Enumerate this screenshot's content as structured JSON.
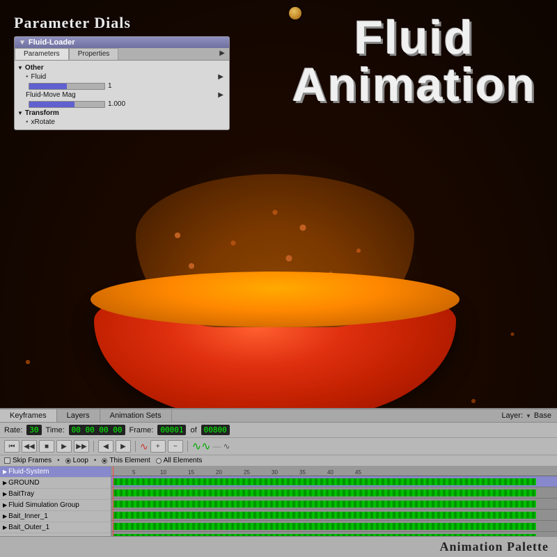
{
  "background": {
    "color": "#1a0800"
  },
  "paramPanel": {
    "title": "Parameter Dials",
    "windowTitle": "Fluid-Loader",
    "tabs": [
      "Parameters",
      "Properties"
    ],
    "activeTab": "Parameters",
    "sections": [
      {
        "name": "Other",
        "collapsed": false,
        "params": [
          {
            "name": "Fluid",
            "sliderValue": 1,
            "sliderPercent": 50,
            "displayValue": "1"
          },
          {
            "name": "Fluid-Move Mag",
            "sliderValue": 1.0,
            "sliderPercent": 60,
            "displayValue": "1.000"
          }
        ]
      },
      {
        "name": "Transform",
        "collapsed": false,
        "params": [
          {
            "name": "xRotate"
          }
        ]
      }
    ]
  },
  "fluidTitle": {
    "line1": "Fluid",
    "line2": "Animation"
  },
  "fallingKibble": {
    "visible": true
  },
  "timelinePanel": {
    "tabs": [
      "Keyframes",
      "Layers",
      "Animation Sets"
    ],
    "activeTab": "Keyframes",
    "layer": {
      "label": "Layer:",
      "value": "Base"
    },
    "controls": {
      "rateLabel": "Rate:",
      "rateValue": "30",
      "timeLabel": "Time:",
      "timeValue": "00 00 00 00",
      "frameLabel": "Frame:",
      "frameValue": "00001",
      "ofLabel": "of",
      "totalFrames": "00800"
    },
    "options": {
      "skipFrames": "Skip Frames",
      "loop": "Loop",
      "thisElement": "This Element",
      "allElements": "All Elements"
    },
    "tracks": [
      {
        "name": "Fluid-System",
        "color": "#cc3333",
        "selected": true
      },
      {
        "name": "GROUND",
        "color": "#cc3333",
        "selected": false
      },
      {
        "name": "BaitTray",
        "color": "#cc3333",
        "selected": false
      },
      {
        "name": "Fluid Simulation Group",
        "color": "#cc3333",
        "selected": false
      },
      {
        "name": "Bait_Inner_1",
        "color": "#cc3333",
        "selected": false
      },
      {
        "name": "Bait_Outer_1",
        "color": "#cc3333",
        "selected": false
      }
    ],
    "rulerMarks": [
      5,
      10,
      15,
      20,
      25,
      30,
      35,
      40,
      45
    ],
    "animPaletteLabel": "Animation Palette"
  },
  "transportButtons": {
    "skipBack": "⏮",
    "stepBack": "⏪",
    "stop": "⏹",
    "play": "▶",
    "stepForward": "⏩",
    "skipForward": "⏭",
    "prevKey": "◀",
    "nextKey": "▶",
    "addKey": "+",
    "removeKey": "−"
  }
}
